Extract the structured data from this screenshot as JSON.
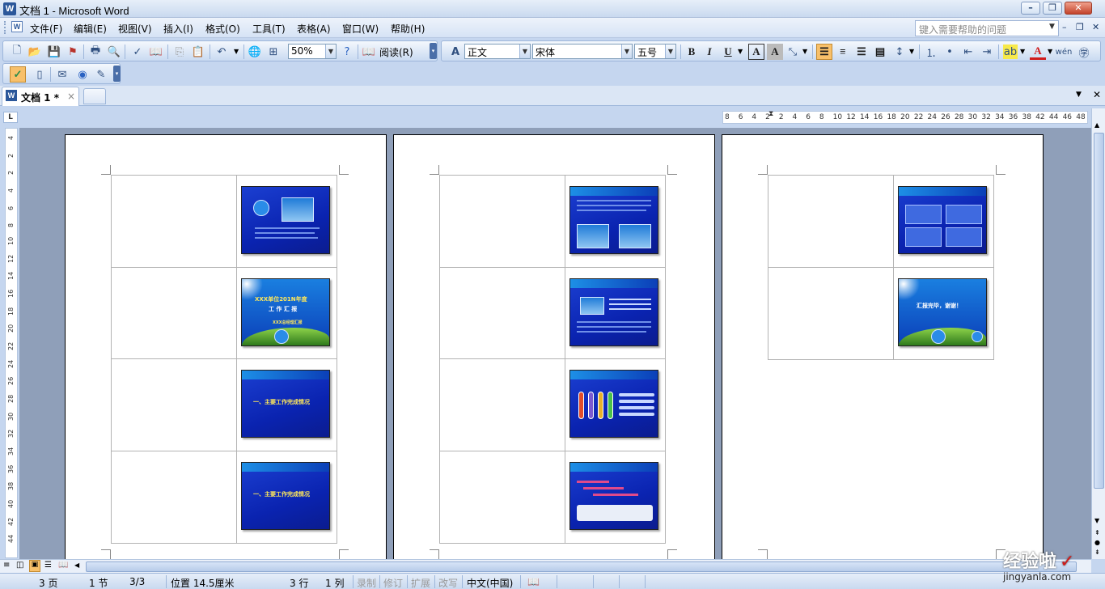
{
  "window": {
    "title": "文档 1 - Microsoft Word"
  },
  "menu": [
    "文件(F)",
    "编辑(E)",
    "视图(V)",
    "插入(I)",
    "格式(O)",
    "工具(T)",
    "表格(A)",
    "窗口(W)",
    "帮助(H)"
  ],
  "help_box": {
    "placeholder": "键入需要帮助的问题"
  },
  "toolbar": {
    "zoom": "50%",
    "read_label": "阅读(R)",
    "style": "正文",
    "font": "宋体",
    "size": "五号",
    "bold": "B",
    "italic": "I",
    "underline": "U",
    "char_border": "A",
    "char_shade": "A",
    "font_color": "A"
  },
  "doc_tab": {
    "label": "文档 1 *",
    "close": "×"
  },
  "ruler": {
    "corner": "L",
    "h_ticks": [
      "8",
      "6",
      "4",
      "2",
      "2",
      "4",
      "6",
      "8",
      "10",
      "12",
      "14",
      "16",
      "18",
      "20",
      "22",
      "24",
      "26",
      "28",
      "30",
      "32",
      "34",
      "36",
      "38",
      "42",
      "44",
      "46",
      "48"
    ],
    "v_ticks": [
      "4",
      "2",
      "2",
      "4",
      "6",
      "8",
      "10",
      "12",
      "14",
      "16",
      "18",
      "20",
      "22",
      "24",
      "26",
      "28",
      "30",
      "32",
      "34",
      "36",
      "38",
      "40",
      "42",
      "44"
    ]
  },
  "slides": {
    "s2_title": "XXX单位201N年度",
    "s2_sub": "工 作 汇 报",
    "s2_small": "XXX总经理汇报",
    "s3_text": "一、主要工作完成情况",
    "s4_text": "一、主要工作完成情况",
    "s_end_text": "汇报完毕，谢谢！"
  },
  "status": {
    "page": "3 页",
    "section": "1 节",
    "pages": "3/3",
    "position": "位置 14.5厘米",
    "line": "3 行",
    "col": "1 列",
    "rec": "录制",
    "trk": "修订",
    "ext": "扩展",
    "ovr": "改写",
    "lang": "中文(中国)"
  },
  "watermark": {
    "line1": "经验啦",
    "check": "✓",
    "line2": "jingyanla.com"
  }
}
